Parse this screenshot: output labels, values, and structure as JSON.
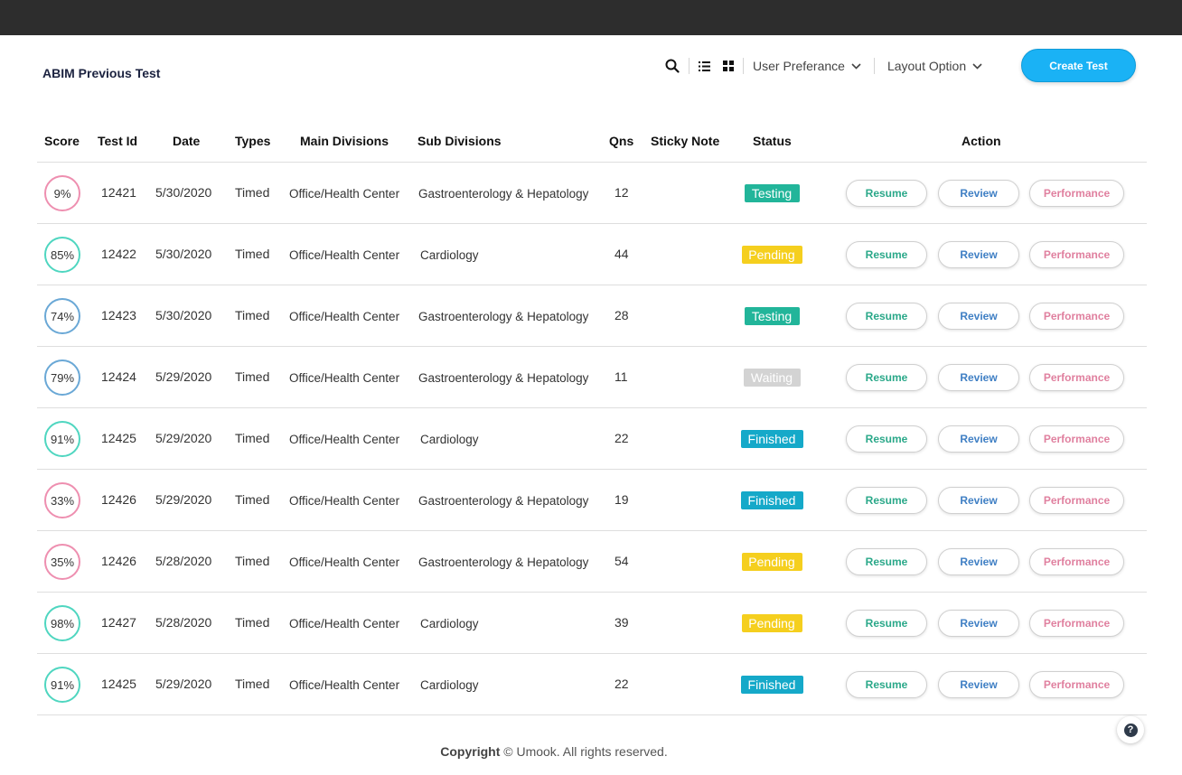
{
  "page": {
    "title": "ABIM Previous Test"
  },
  "toolbar": {
    "search_icon": "search-icon",
    "list_icon": "list-view-icon",
    "grid_icon": "grid-view-icon",
    "user_pref_label": "User Preferance",
    "layout_label": "Layout Option",
    "create_label": "Create Test"
  },
  "table": {
    "headers": [
      "Score",
      "Test Id",
      "Date",
      "Types",
      "Main Divisions",
      "Sub Divisions",
      "Qns",
      "Sticky Note",
      "Status",
      "Action"
    ],
    "actions": {
      "resume": "Resume",
      "review": "Review",
      "performance": "Performance"
    },
    "rows": [
      {
        "score": "9%",
        "score_color": "#ee8fb0",
        "id": "12421",
        "date": "5/30/2020",
        "type": "Timed",
        "main": "Office/Health Center",
        "sub": "Gastroenterology & Hepatology",
        "qns": "12",
        "note": "",
        "status": "Testing",
        "status_color": "#22b59a"
      },
      {
        "score": "85%",
        "score_color": "#4fd6c0",
        "id": "12422",
        "date": "5/30/2020",
        "type": "Timed",
        "main": "Office/Health Center",
        "sub": "Cardiology",
        "qns": "44",
        "note": "",
        "status": "Pending",
        "status_color": "#f5cf1e"
      },
      {
        "score": "74%",
        "score_color": "#6aa8d6",
        "id": "12423",
        "date": "5/30/2020",
        "type": "Timed",
        "main": "Office/Health Center",
        "sub": "Gastroenterology & Hepatology",
        "qns": "28",
        "note": "",
        "status": "Testing",
        "status_color": "#22b59a"
      },
      {
        "score": "79%",
        "score_color": "#6aa8d6",
        "id": "12424",
        "date": "5/29/2020",
        "type": "Timed",
        "main": "Office/Health Center",
        "sub": "Gastroenterology & Hepatology",
        "qns": "11",
        "note": "",
        "status": "Waiting",
        "status_color": "#d3d3d3"
      },
      {
        "score": "91%",
        "score_color": "#4fd6c0",
        "id": "12425",
        "date": "5/29/2020",
        "type": "Timed",
        "main": "Office/Health Center",
        "sub": "Cardiology",
        "qns": "22",
        "note": "",
        "status": "Finished",
        "status_color": "#15a9c9"
      },
      {
        "score": "33%",
        "score_color": "#ee8fb0",
        "id": "12426",
        "date": "5/29/2020",
        "type": "Timed",
        "main": "Office/Health Center",
        "sub": "Gastroenterology & Hepatology",
        "qns": "19",
        "note": "",
        "status": "Finished",
        "status_color": "#15a9c9"
      },
      {
        "score": "35%",
        "score_color": "#ee8fb0",
        "id": "12426",
        "date": "5/28/2020",
        "type": "Timed",
        "main": "Office/Health Center",
        "sub": "Gastroenterology & Hepatology",
        "qns": "54",
        "note": "",
        "status": "Pending",
        "status_color": "#f5cf1e"
      },
      {
        "score": "98%",
        "score_color": "#4fd6c0",
        "id": "12427",
        "date": "5/28/2020",
        "type": "Timed",
        "main": "Office/Health Center",
        "sub": "Cardiology",
        "qns": "39",
        "note": "",
        "status": "Pending",
        "status_color": "#f5cf1e"
      },
      {
        "score": "91%",
        "score_color": "#4fd6c0",
        "id": "12425",
        "date": "5/29/2020",
        "type": "Timed",
        "main": "Office/Health Center",
        "sub": "Cardiology",
        "qns": "22",
        "note": "",
        "status": "Finished",
        "status_color": "#15a9c9"
      }
    ]
  },
  "colors": {
    "resume": "#2aa889",
    "review": "#3f7fc4",
    "performance": "#e0809f",
    "accent": "#1ab2f5"
  },
  "footer": {
    "copyright_bold": "Copyright",
    "copyright_rest": "© Umook. All rights reserved."
  },
  "help": {
    "label": "?"
  }
}
